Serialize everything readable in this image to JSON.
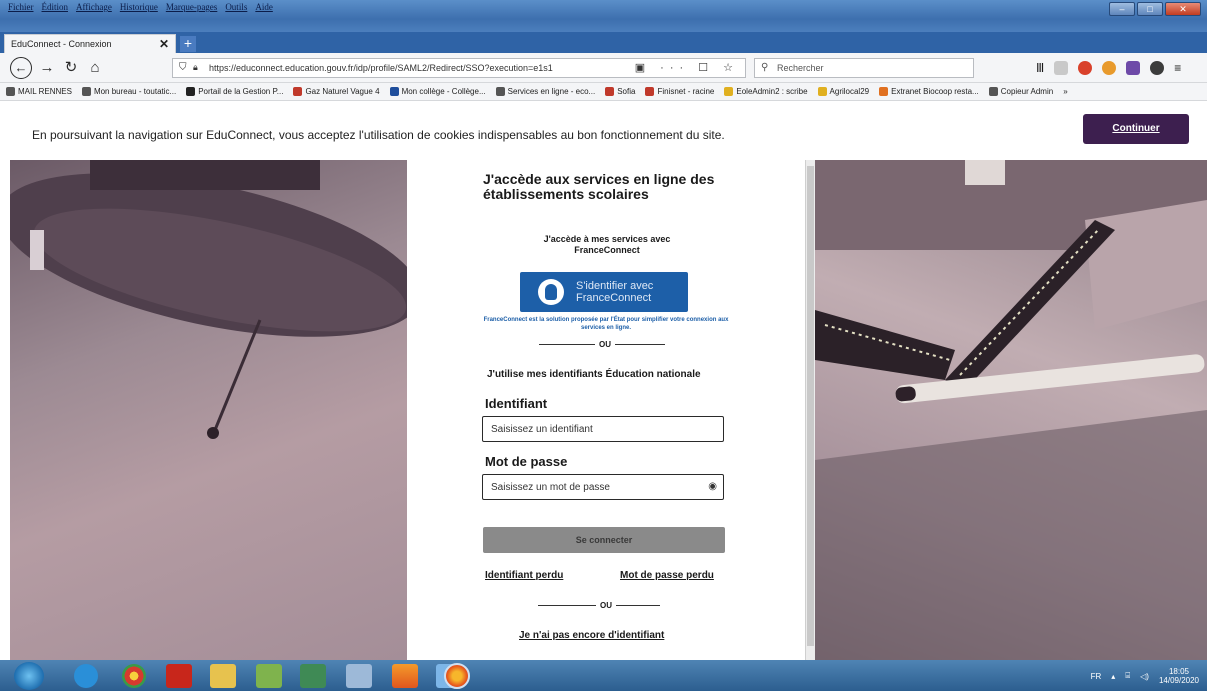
{
  "window": {
    "menu": [
      "Fichier",
      "Édition",
      "Affichage",
      "Historique",
      "Marque-pages",
      "Outils",
      "Aide"
    ],
    "tab_title": "EduConnect - Connexion",
    "tab_close": "✕",
    "new_tab": "+"
  },
  "navbar": {
    "url": "https://educonnect.education.gouv.fr/idp/profile/SAML2/Redirect/SSO?execution=e1s1",
    "url_icons": "▣ ··· ☐ ☆",
    "search_placeholder": "Rechercher"
  },
  "bookmarks": [
    {
      "label": "MAIL RENNES",
      "color": "#555555"
    },
    {
      "label": "Mon bureau - toutatic...",
      "color": "#555555"
    },
    {
      "label": "Portail de la Gestion P...",
      "color": "#222222"
    },
    {
      "label": "Gaz Naturel Vague 4",
      "color": "#c0392b"
    },
    {
      "label": "Mon collège - Collège...",
      "color": "#1f4e9c"
    },
    {
      "label": "Services en ligne - eco...",
      "color": "#555555"
    },
    {
      "label": "Sofia",
      "color": "#c0392b"
    },
    {
      "label": "Finisnet - racine",
      "color": "#c0392b"
    },
    {
      "label": "EoleAdmin2 : scribe",
      "color": "#e0b020"
    },
    {
      "label": "Agrilocal29",
      "color": "#e0b020"
    },
    {
      "label": "Extranet Biocoop resta...",
      "color": "#e07020"
    },
    {
      "label": "Copieur Admin",
      "color": "#555555"
    }
  ],
  "cookie": {
    "message": "En poursuivant la navigation sur EduConnect, vous acceptez l'utilisation de cookies indispensables au bon fonctionnement du site.",
    "button": "Continuer"
  },
  "login": {
    "title": "J'accède aux services en ligne des établissements scolaires",
    "fc_intro": "J'accède à mes services avec FranceConnect",
    "fc_button_line1": "S'identifier avec",
    "fc_button_line2": "FranceConnect",
    "fc_description": "FranceConnect est la solution proposée par l'État pour simplifier votre connexion aux services en ligne.",
    "or": "OU",
    "edu_intro": "J'utilise mes identifiants Éducation nationale",
    "id_label": "Identifiant",
    "id_placeholder": "Saisissez un identifiant",
    "pw_label": "Mot de passe",
    "pw_placeholder": "Saisissez un mot de passe",
    "submit": "Se connecter",
    "forgot_id": "Identifiant perdu",
    "forgot_pw": "Mot de passe perdu",
    "no_id": "Je n'ai pas encore d'identifiant"
  },
  "taskbar": {
    "lang": "FR",
    "time": "18:05",
    "date": "14/09/2020"
  },
  "colors": {
    "primary_dark": "#3d1f4f",
    "franceconnect_blue": "#1d5fa8",
    "submit_gray": "#8a8a8a"
  }
}
